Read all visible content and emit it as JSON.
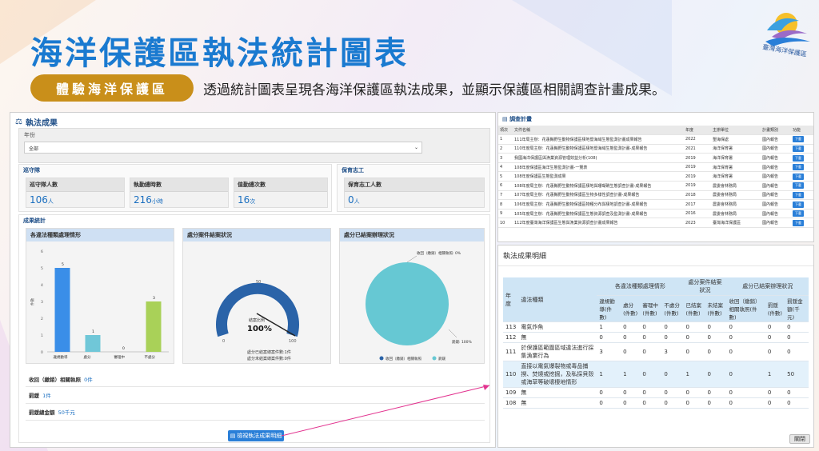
{
  "header": {
    "title": "海洋保護區執法統計圖表",
    "logo_text": "臺灣海洋保護區"
  },
  "banner": {
    "pill": "體驗海洋保護區",
    "subtitle": "透過統計圖表呈現各海洋保護區執法成果，並顯示保護區相關調查計畫成果。"
  },
  "left": {
    "title": "執法成果",
    "year_label": "年份",
    "year_value": "全部",
    "patrol": {
      "title": "巡守隊",
      "kpis": [
        {
          "label": "巡守隊人數",
          "value": "106",
          "unit": "人"
        },
        {
          "label": "執勤總時數",
          "value": "216",
          "unit": "小時"
        },
        {
          "label": "值勤總次數",
          "value": "16",
          "unit": "次"
        }
      ]
    },
    "volunteer": {
      "title": "保育志工",
      "kpis": [
        {
          "label": "保育志工人數",
          "value": "0",
          "unit": "人"
        }
      ]
    },
    "stats": {
      "title": "成果統計"
    },
    "bar": {
      "title": "各違法種類處理情形",
      "ylabel": "件數",
      "ticks": [
        "0",
        "1",
        "2",
        "3",
        "4",
        "5",
        "6"
      ]
    },
    "gauge": {
      "title": "處分案件結案狀況",
      "ratio_label": "結案比例",
      "ratio_value": "100%",
      "tick_0": "0",
      "tick_50": "50",
      "tick_100": "100",
      "line1": "處分已結案總案件數:1件",
      "line2": "處分未結案總案件數:0件"
    },
    "pie": {
      "title": "處分已結案辦理狀況",
      "top_label": "收回（繳銷）相關執照: 0%",
      "right_label": "罰鍰: 100%",
      "legend": [
        "收回（繳銷）相關執照",
        "罰鍰"
      ]
    },
    "summary": [
      {
        "label": "收回（繳銷）相關執照",
        "value": "0件"
      },
      {
        "label": "罰鍰",
        "value": "1件"
      },
      {
        "label": "罰鍰總金額",
        "value": "50千元"
      }
    ],
    "detail_button": "檢視執法成果明細"
  },
  "chart_data": {
    "type": "bar",
    "categories": [
      "違規勸導",
      "處分",
      "審理中",
      "不處分"
    ],
    "values": [
      5,
      1,
      0,
      3
    ],
    "ylim": [
      0,
      6
    ],
    "colors": [
      "#3a8ee8",
      "#70c7d8",
      "#6a6a6a",
      "#a9d158"
    ]
  },
  "plans": {
    "title": "調查計畫",
    "headers": [
      "項次",
      "文件名稱",
      "年度",
      "主辦單位",
      "計畫類別",
      "功能"
    ],
    "download": "下載",
    "rows": [
      {
        "no": "1",
        "name": "111年局主辦：花蓮縣野生動物保護區棲地暨海域生態監測計畫成果報告",
        "year": "2022",
        "unit": "墾海保處",
        "type": "國內報告"
      },
      {
        "no": "2",
        "name": "110年度局主辦：花蓮縣野生動物保護區棲地暨海域生態監測計畫-成果報告",
        "year": "2021",
        "unit": "海洋保育署",
        "type": "國內報告"
      },
      {
        "no": "3",
        "name": "我國海洋保護區與漁業資源管理效益分析(108)",
        "year": "2019",
        "unit": "海洋保育署",
        "type": "國內報告"
      },
      {
        "no": "4",
        "name": "108年度保護區海洋生態監測計畫-一覽表",
        "year": "2019",
        "unit": "海洋保育署",
        "type": "國內報告"
      },
      {
        "no": "5",
        "name": "108年度保護區生態監測成果",
        "year": "2019",
        "unit": "海洋保育署",
        "type": "國內報告"
      },
      {
        "no": "6",
        "name": "108年度局主辦：花蓮縣野生動物保護區棲地與珊瑚礁生態調查計畫-成果報告",
        "year": "2019",
        "unit": "農委會林務局",
        "type": "國內報告"
      },
      {
        "no": "7",
        "name": "107年度局主辦：花蓮縣野生動物保護區生物多樣性調查計畫-成果報告",
        "year": "2018",
        "unit": "農委會林務局",
        "type": "國內報告"
      },
      {
        "no": "8",
        "name": "106年度局主辦：花蓮縣野生動物保護區物種分布與棲地調查計畫-成果報告",
        "year": "2017",
        "unit": "農委會林務局",
        "type": "國內報告"
      },
      {
        "no": "9",
        "name": "105年度局主辦：花蓮縣野生動物保護區生態資源調查及監測計畫-成果報告",
        "year": "2016",
        "unit": "農委會林務局",
        "type": "國內報告"
      },
      {
        "no": "10",
        "name": "112年度臺灣海洋保護區生態與漁業資源調查計畫成果報告",
        "year": "2023",
        "unit": "臺灣海洋保護區",
        "type": "國內報告"
      }
    ]
  },
  "results": {
    "title": "執法成果明細",
    "group1": "各違法種類處理情形",
    "group2": "處分案件結案狀況",
    "group3": "處分已結案辦理狀況",
    "col_year": "年度",
    "col_type": "違法種類",
    "cols": [
      "違規勸導(件數)",
      "處分(件數)",
      "審理中(件數)",
      "不處分(件數)",
      "已結案(件數)",
      "未結案(件數)",
      "收回（繳銷）相關執照(件數)",
      "罰鍰(件數)",
      "罰鍰金額(千元)"
    ],
    "rows": [
      {
        "year": "113",
        "type": "電氣炸魚",
        "v": [
          "1",
          "0",
          "0",
          "0",
          "0",
          "0",
          "0",
          "0",
          "0"
        ]
      },
      {
        "year": "112",
        "type": "無",
        "v": [
          "0",
          "0",
          "0",
          "0",
          "0",
          "0",
          "0",
          "0",
          "0"
        ]
      },
      {
        "year": "111",
        "type": "於保護區範圍區域違法進行採集漁業行為",
        "v": [
          "3",
          "0",
          "0",
          "3",
          "0",
          "0",
          "0",
          "0",
          "0"
        ]
      },
      {
        "year": "110",
        "type": "直接以電氣爆裂物或毒品捕撈、焚燒或挖掘，及私採貝殼或海草等破壞棲地情形",
        "v": [
          "1",
          "1",
          "0",
          "0",
          "1",
          "0",
          "0",
          "1",
          "50"
        ]
      },
      {
        "year": "109",
        "type": "無",
        "v": [
          "0",
          "0",
          "0",
          "0",
          "0",
          "0",
          "0",
          "0",
          "0"
        ]
      },
      {
        "year": "108",
        "type": "無",
        "v": [
          "0",
          "0",
          "0",
          "0",
          "0",
          "0",
          "0",
          "0",
          "0"
        ]
      }
    ],
    "close_button": "關閉"
  }
}
